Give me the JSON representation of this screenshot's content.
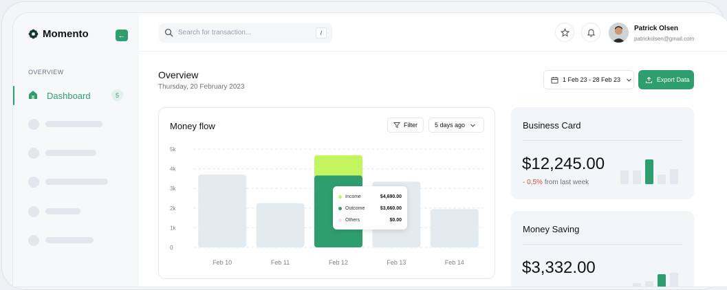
{
  "app": {
    "name": "Momento"
  },
  "sidebar": {
    "section": "OVERVIEW",
    "active": {
      "label": "Dashboard",
      "count": "5"
    },
    "placeholders": 5
  },
  "search": {
    "placeholder": "Search for transaction...",
    "shortcut": "/"
  },
  "user": {
    "name": "Patrick Olsen",
    "email": "patrickolsen@gmail.com"
  },
  "page": {
    "title": "Overview",
    "date": "Thursday, 20 February 2023"
  },
  "toolbar": {
    "date_range": "1 Feb 23 - 28 Feb 23",
    "export_label": "Export Data"
  },
  "money_flow": {
    "title": "Money flow",
    "filter_label": "Filter",
    "period_label": "5 days ago",
    "tooltip": [
      {
        "name": "Income",
        "value": "$4,690.00",
        "color": "#c4f560"
      },
      {
        "name": "Outcome",
        "value": "$3,660.00",
        "color": "#2f9e6e"
      },
      {
        "name": "Others",
        "value": "$0.00",
        "color": "#e1e7ee"
      }
    ]
  },
  "chart_data": {
    "type": "bar",
    "categories": [
      "Feb 10",
      "Feb 11",
      "Feb 12",
      "Feb 13",
      "Feb 14"
    ],
    "series": [
      {
        "name": "Income",
        "values": [
          null,
          null,
          4690,
          null,
          null
        ]
      },
      {
        "name": "Outcome",
        "values": [
          3700,
          2250,
          3660,
          3350,
          1950
        ]
      }
    ],
    "y_ticks": [
      "5k",
      "4k",
      "3k",
      "2k",
      "1k",
      "0"
    ],
    "ylim": [
      0,
      5000
    ],
    "highlight_category": "Feb 12",
    "grid": "dashed horizontal",
    "colors": {
      "bar": "#e3eaf0",
      "outcome_active": "#2f9e6e",
      "income_active": "#c4f560"
    }
  },
  "business_card": {
    "title": "Business Card",
    "amount": "$12,245.00",
    "change": "- 0,5%",
    "change_suffix": "from last week",
    "mini_bars": [
      0.55,
      0.55,
      1.0,
      0.4,
      0.62
    ]
  },
  "money_saving": {
    "title": "Money Saving",
    "amount": "$3,332.00",
    "mini_bars": [
      0.3,
      0.45,
      0.9,
      1.0
    ]
  },
  "colors": {
    "accent": "#2f9e6e",
    "negative": "#e0483e"
  }
}
